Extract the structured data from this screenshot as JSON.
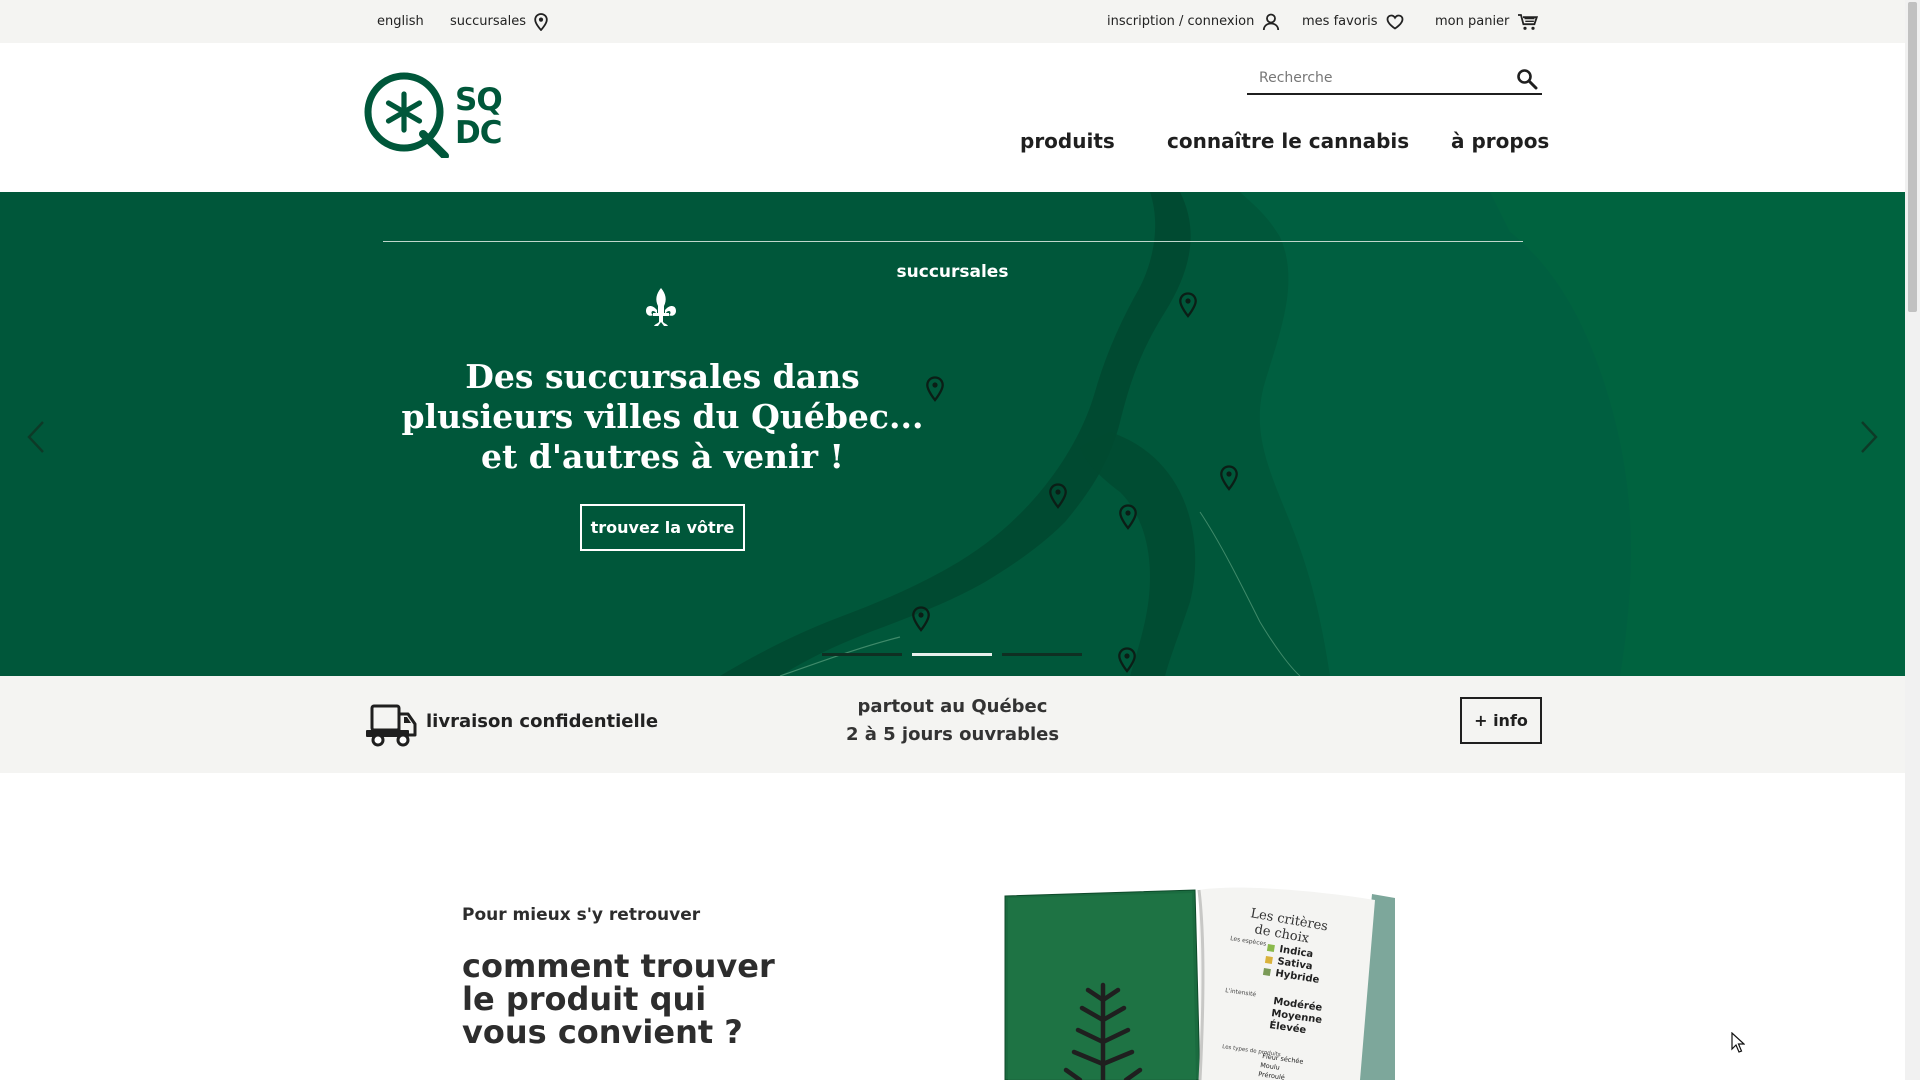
{
  "colors": {
    "brand_green": "#00573a",
    "map_light": "#005f40",
    "map_dark": "#004a31",
    "text_dark": "#1f1f1f",
    "band_bg": "#f4f4f2"
  },
  "topbar": {
    "english": "english",
    "stores": "succursales",
    "stores_icon": "map-pin-icon",
    "login": "inscription / connexion",
    "login_icon": "user-icon",
    "favorites": "mes favoris",
    "favorites_icon": "heart-icon",
    "cart": "mon panier",
    "cart_icon": "cart-icon"
  },
  "header": {
    "logo_text": [
      "SQ",
      "DC"
    ],
    "search_placeholder": "Recherche",
    "search_icon": "search-icon",
    "nav": {
      "products": "produits",
      "learn": "connaître le cannabis",
      "about": "à propos"
    }
  },
  "hero": {
    "kicker": "succursales",
    "emblem_icon": "fleur-de-lis-icon",
    "headline": [
      "Des succursales dans",
      "plusieurs villes du Québec...",
      "et d'autres à venir !"
    ],
    "cta": "trouvez la vôtre",
    "prev_icon": "chevron-left-icon",
    "next_icon": "chevron-right-icon",
    "slides_total": 3,
    "active_slide": 2
  },
  "delivery": {
    "icon": "truck-icon",
    "label": "livraison confidentielle",
    "where_line1": "partout au Québec",
    "where_line2": "2 à 5 jours ouvrables",
    "info_button": "+ info"
  },
  "promo": {
    "kicker": "Pour mieux s'y retrouver",
    "title": [
      "comment trouver",
      "le produit qui",
      "vous convient ?"
    ],
    "book": {
      "page_title": [
        "Les critères",
        "de choix"
      ],
      "species_label": "Les espèces",
      "species": [
        "Indica",
        "Sativa",
        "Hybride"
      ],
      "intensity_label": "L'intensité",
      "intensity": [
        "Modérée",
        "Moyenne",
        "Élevée"
      ],
      "types_label": "Les types de produits",
      "types": [
        "Fleur séchée",
        "Moulu",
        "Préroulé"
      ]
    }
  }
}
